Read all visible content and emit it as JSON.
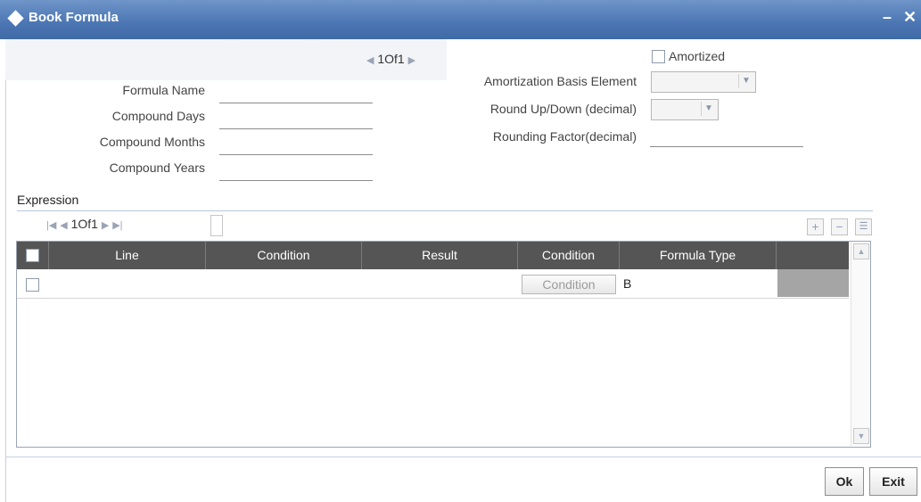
{
  "window": {
    "title": "Book Formula",
    "minimize": "–",
    "close": "✕"
  },
  "top_pager": {
    "text": "1Of1"
  },
  "form": {
    "formula_name": "Formula Name",
    "compound_days": "Compound Days",
    "compound_months": "Compound Months",
    "compound_years": "Compound Years",
    "amortized": "Amortized",
    "amortization_basis": "Amortization Basis Element",
    "round_updown": "Round Up/Down (decimal)",
    "rounding_factor": "Rounding Factor(decimal)"
  },
  "expression": {
    "title": "Expression",
    "pager": "1Of1",
    "columns": [
      "Line",
      "Condition",
      "Result",
      "Condition",
      "Formula Type"
    ],
    "rows": [
      {
        "condition_button": "Condition",
        "formula_type": "B"
      }
    ]
  },
  "footer": {
    "ok": "Ok",
    "exit": "Exit"
  }
}
